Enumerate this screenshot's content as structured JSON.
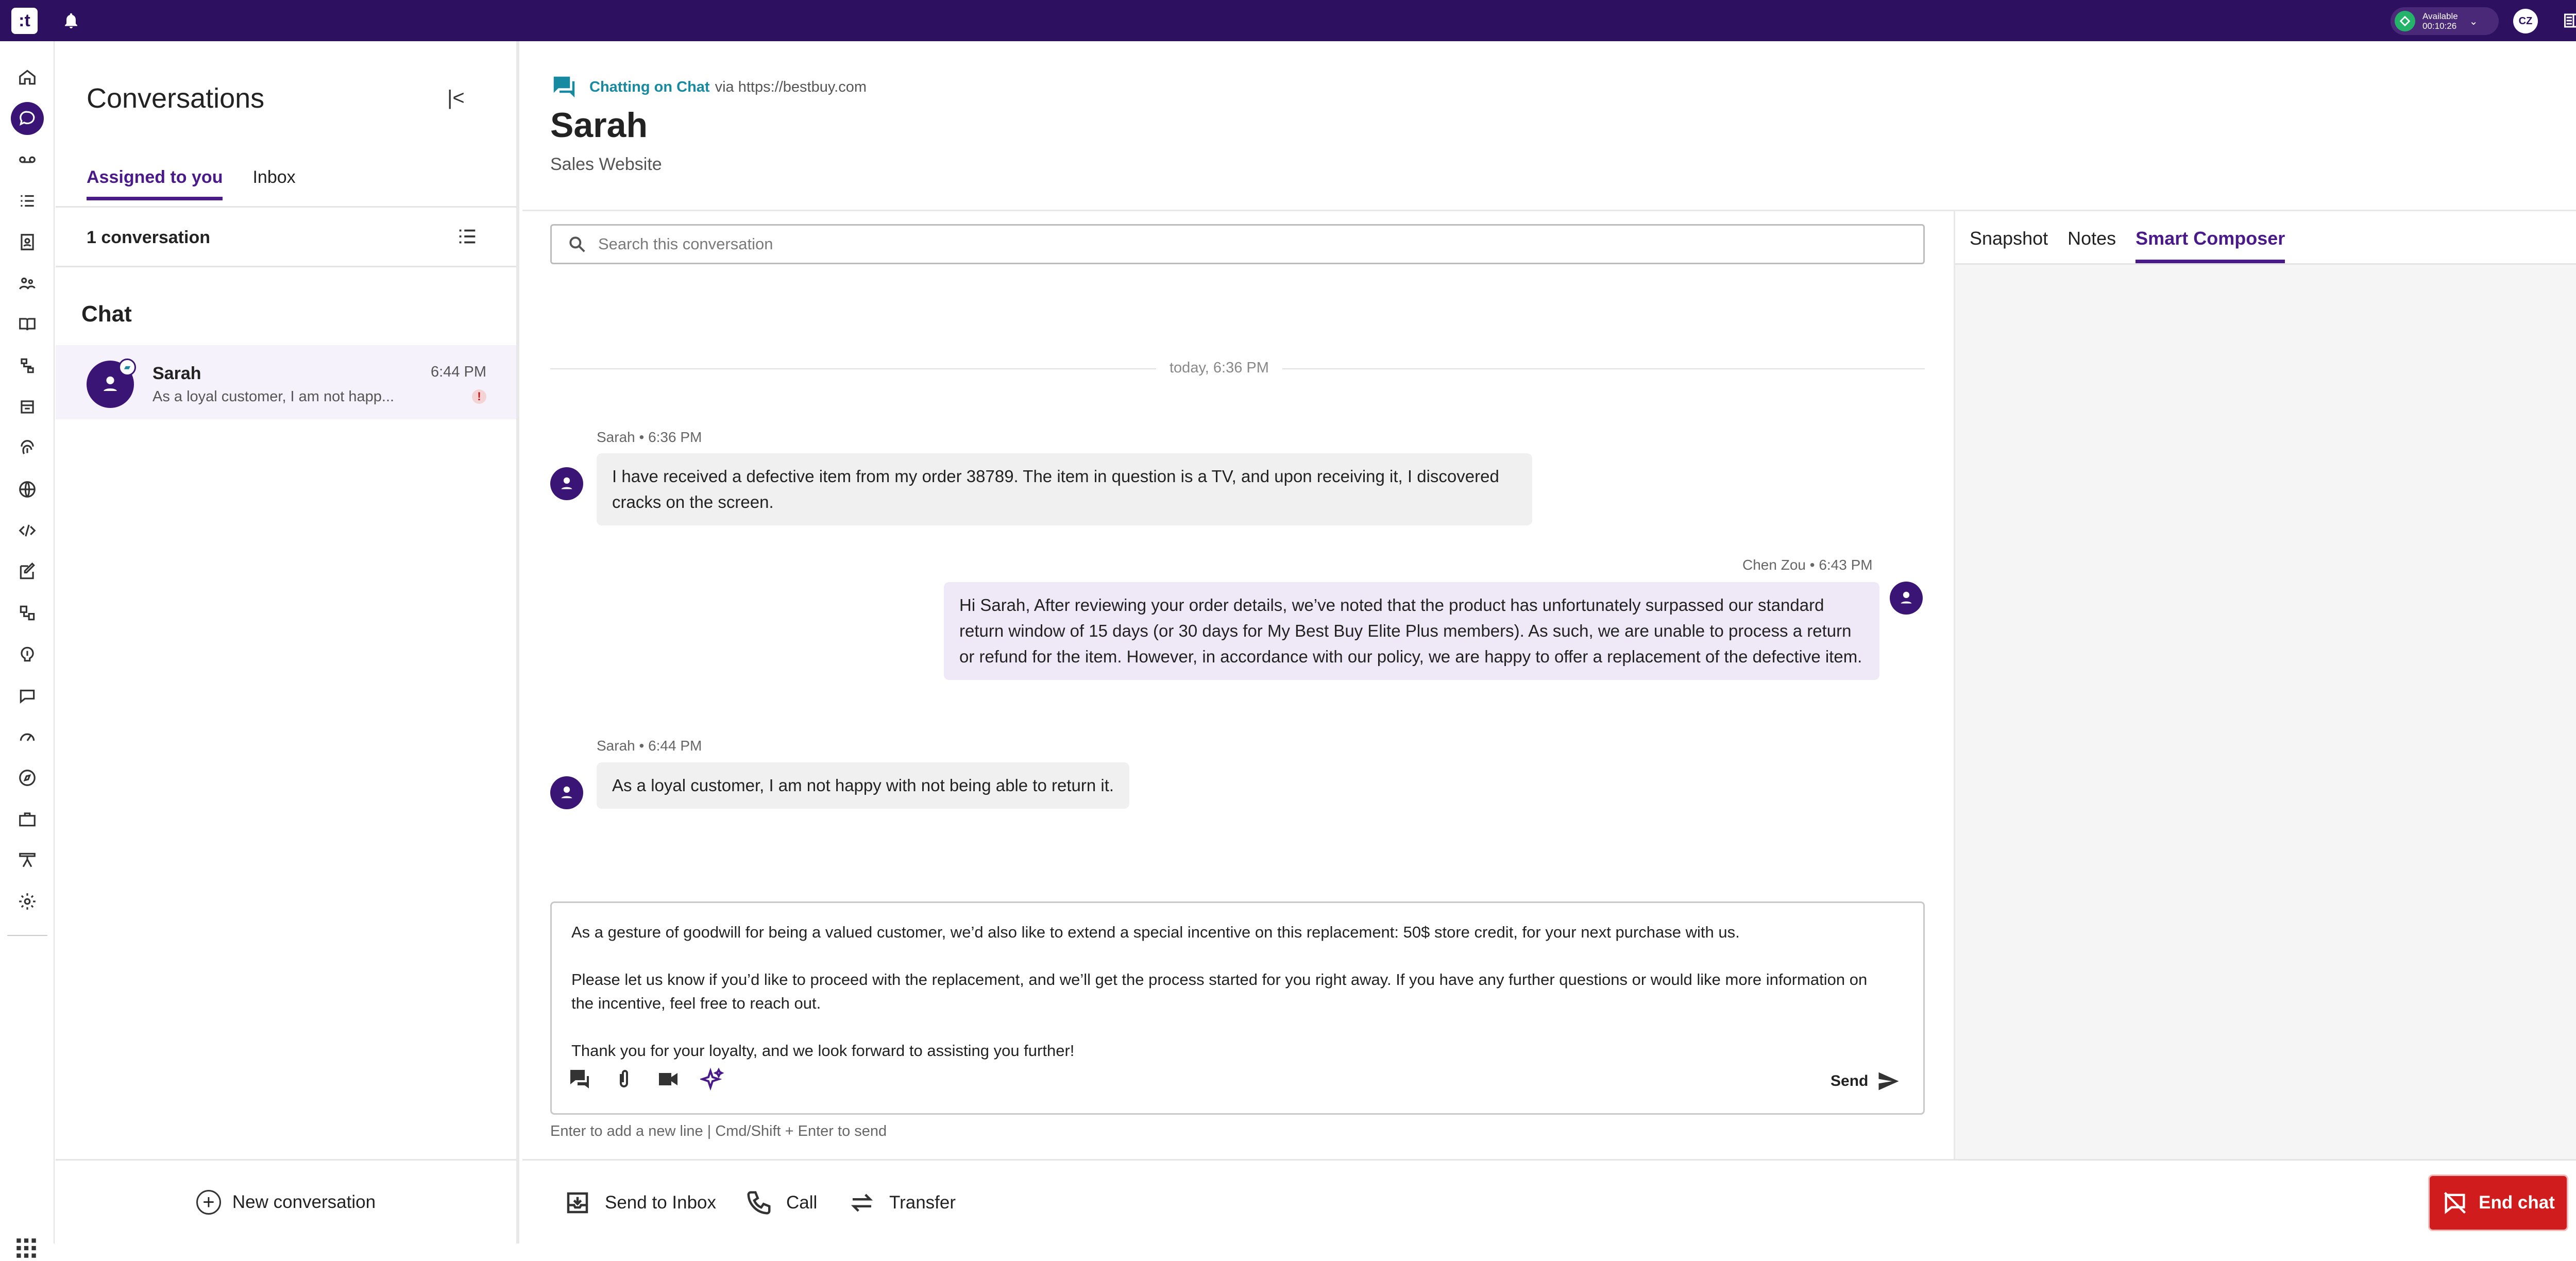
{
  "topbar": {
    "logo": ":t",
    "status_label": "Available",
    "status_timer": "00:10:26",
    "user_initials": "CZ"
  },
  "conversations": {
    "title": "Conversations",
    "tabs": [
      {
        "label": "Assigned to you"
      },
      {
        "label": "Inbox"
      }
    ],
    "count_label": "1 conversation",
    "section": "Chat",
    "items": [
      {
        "name": "Sarah",
        "preview": "As a loyal customer, I am not happ...",
        "time": "6:44 PM"
      }
    ],
    "new_conversation": "New conversation"
  },
  "header": {
    "channel": "Chatting on Chat",
    "via": "via https://bestbuy.com",
    "customer": "Sarah",
    "source": "Sales Website"
  },
  "search": {
    "placeholder": "Search this conversation"
  },
  "right_panel": {
    "tabs": [
      {
        "label": "Snapshot"
      },
      {
        "label": "Notes"
      },
      {
        "label": "Smart Composer"
      }
    ]
  },
  "thread": {
    "day": "today, 6:36 PM",
    "messages": [
      {
        "meta": "Sarah • 6:36 PM",
        "text": "I have received a defective item from my order 38789. The item in question is a TV, and upon receiving it, I discovered cracks on the screen."
      },
      {
        "meta": "Chen Zou • 6:43 PM",
        "text": "Hi Sarah, After reviewing your order details, we’ve noted that the product has unfortunately surpassed our standard return window of 15 days (or 30 days for My Best Buy Elite Plus members). As such, we are unable to process a return or refund for the item. However, in accordance with our policy, we are happy to offer a replacement of the defective item."
      },
      {
        "meta": "Sarah • 6:44 PM",
        "text": "As a loyal customer, I am not happy with not being able to return it."
      }
    ]
  },
  "composer": {
    "p1": "As a gesture of goodwill for being a valued customer, we’d also like to extend a special incentive on this replacement: 50$ store credit, for your next purchase with us.",
    "p2": "Please let us know if you’d like to proceed with the replacement, and we’ll get the process started for you right away. If you have any further questions or would like more information on the incentive, feel free to reach out.",
    "p3": "Thank you for your loyalty, and we look forward to assisting you further!",
    "send": "Send",
    "hint": "Enter to add a new line | Cmd/Shift + Enter to send"
  },
  "footer": {
    "send_to_inbox": "Send to Inbox",
    "call": "Call",
    "transfer": "Transfer",
    "end_chat": "End chat"
  },
  "colors": {
    "brand": "#2d1060",
    "accent": "#4a1a8a",
    "danger": "#d01c1c",
    "link": "#168aa0"
  }
}
